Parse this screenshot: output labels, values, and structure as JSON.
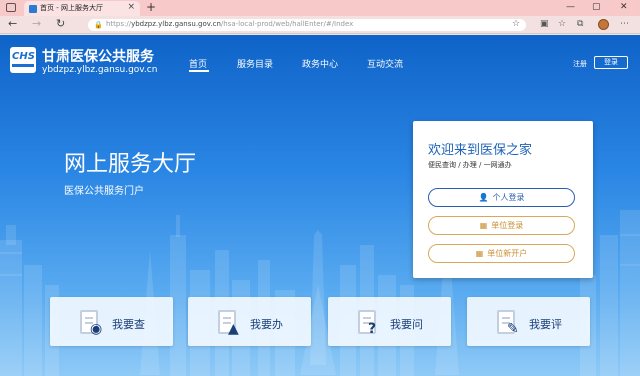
{
  "browser": {
    "tab_title": "首页 - 网上服务大厅",
    "tab_close": "×",
    "new_tab": "+",
    "window_controls": [
      "—",
      "▢",
      "✕"
    ],
    "nav": {
      "back": "←",
      "forward": "→",
      "reload": "↻"
    },
    "url_lock": "🔒",
    "url_prefix": "https://",
    "url_domain": "ybdzpz.ylbz.gansu.gov.cn",
    "url_path": "/hsa-local-prod/web/hallEnter/#/Index",
    "toolbar_icons": [
      "☆",
      "▣",
      "☆",
      "⧉",
      "⋯"
    ]
  },
  "header": {
    "logo_text": "CHS",
    "site_name": "甘肃医保公共服务",
    "site_domain": "ybdzpz.ylbz.gansu.gov.cn",
    "nav": [
      "首页",
      "服务目录",
      "政务中心",
      "互动交流"
    ],
    "register": "注册",
    "login": "登录"
  },
  "hero": {
    "title": "网上服务大厅",
    "subtitle": "医保公共服务门户"
  },
  "login_card": {
    "title": "欢迎来到医保之家",
    "subtitle": "便民查询 / 办理 / 一网通办",
    "buttons": [
      {
        "icon": "👤",
        "label": "个人登录"
      },
      {
        "icon": "▦",
        "label": "单位登录"
      },
      {
        "icon": "▦",
        "label": "单位新开户"
      }
    ]
  },
  "services": [
    {
      "icon": "◉",
      "label": "我要查"
    },
    {
      "icon": "▲",
      "label": "我要办"
    },
    {
      "icon": "?",
      "label": "我要问"
    },
    {
      "icon": "✎",
      "label": "我要评"
    }
  ],
  "colors": {
    "brand_blue": "#1d63b8",
    "accent_gold": "#c98e2e",
    "tab_bar": "#f7c9c9"
  }
}
